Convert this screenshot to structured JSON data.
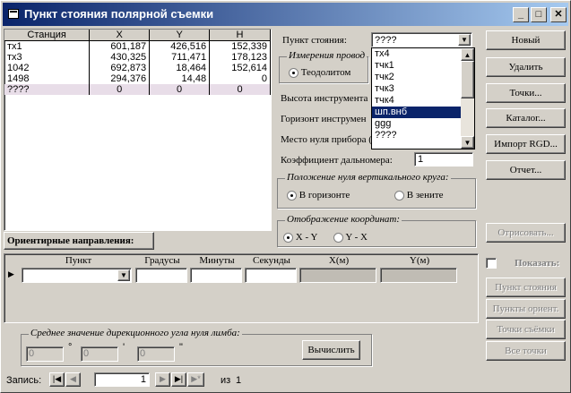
{
  "window": {
    "title": "Пункт стояния полярной съемки"
  },
  "stations_table": {
    "columns": [
      "Станция",
      "X",
      "Y",
      "H"
    ],
    "rows": [
      [
        "тх1",
        "601,187",
        "426,516",
        "152,339"
      ],
      [
        "тх3",
        "430,325",
        "711,471",
        "178,123"
      ],
      [
        "1042",
        "692,873",
        "18,464",
        "152,614"
      ],
      [
        "1498",
        "294,376",
        "14,48",
        "0"
      ],
      [
        "????",
        "0",
        "0",
        "0"
      ]
    ]
  },
  "station_point": {
    "label": "Пункт стояния:",
    "value": "????"
  },
  "dropdown": {
    "items": [
      "тх4",
      "тчк1",
      "тчк2",
      "тчк3",
      "тчк4",
      "шп.внб",
      "ggg",
      "????"
    ],
    "selected": "шп.внб"
  },
  "measure_group": {
    "caption": "Измерения провод",
    "option": "Теодолитом"
  },
  "labels": {
    "instr_height": "Высота инструмента",
    "instr_horizon": "Горизонт инструмен",
    "zero_place": "Место нуля прибора (",
    "rangefinder_coef": "Коэффициент дальномера:",
    "rangefinder_value": "1"
  },
  "vertical_zero_group": {
    "caption": "Положение нуля вертикального круга:",
    "options": [
      "В горизонте",
      "В зените"
    ]
  },
  "coords_group": {
    "caption": "Отображение координат:",
    "options": [
      "X - Y",
      "Y - X"
    ]
  },
  "buttons": {
    "new": "Новый",
    "delete": "Удалить",
    "points": "Точки...",
    "catalog": "Каталог...",
    "import_rgd": "Импорт RGD...",
    "report": "Отчет...",
    "draw": "Отрисовать...",
    "calc": "Вычислить"
  },
  "show": {
    "label": "Показать:",
    "buttons": [
      "Пункт стояния",
      "Пункты ориент.",
      "Точки съёмки",
      "Все точки"
    ]
  },
  "orient": {
    "header_button": "Ориентирные направления:",
    "columns": [
      "Пункт",
      "Градусы",
      "Минуты",
      "Секунды",
      "X(м)",
      "Y(м)"
    ]
  },
  "avg_group": {
    "caption": "Среднее значение дирекционного угла нуля лимба:",
    "deg": "0",
    "min": "0",
    "sec": "0",
    "deg_sym": "°",
    "min_sym": "'",
    "sec_sym": "\""
  },
  "nav": {
    "label": "Запись:",
    "current": "1",
    "of_label": "из",
    "total": "1"
  }
}
